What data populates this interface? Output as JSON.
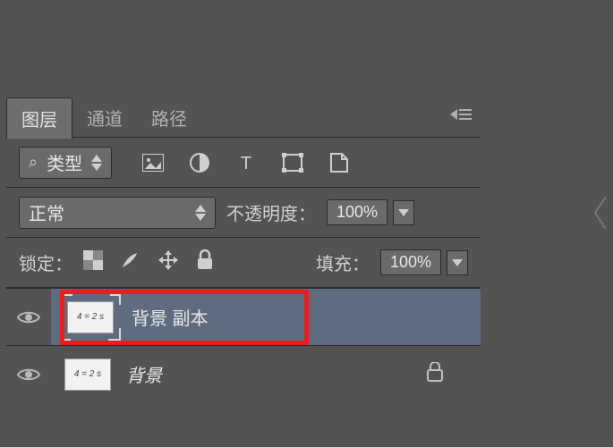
{
  "tabs": {
    "layers": "图层",
    "channels": "通道",
    "paths": "路径"
  },
  "filter": {
    "type_label": "类型"
  },
  "blend": {
    "mode": "正常",
    "opacity_label": "不透明度：",
    "opacity_value": "100%"
  },
  "lock": {
    "label": "锁定：",
    "fill_label": "填充：",
    "fill_value": "100%"
  },
  "layers": [
    {
      "name": "背景 副本",
      "thumb_text": "4 = 2 s",
      "selected": true,
      "locked": false
    },
    {
      "name": "背景",
      "thumb_text": "4 = 2 s",
      "selected": false,
      "locked": true
    }
  ]
}
